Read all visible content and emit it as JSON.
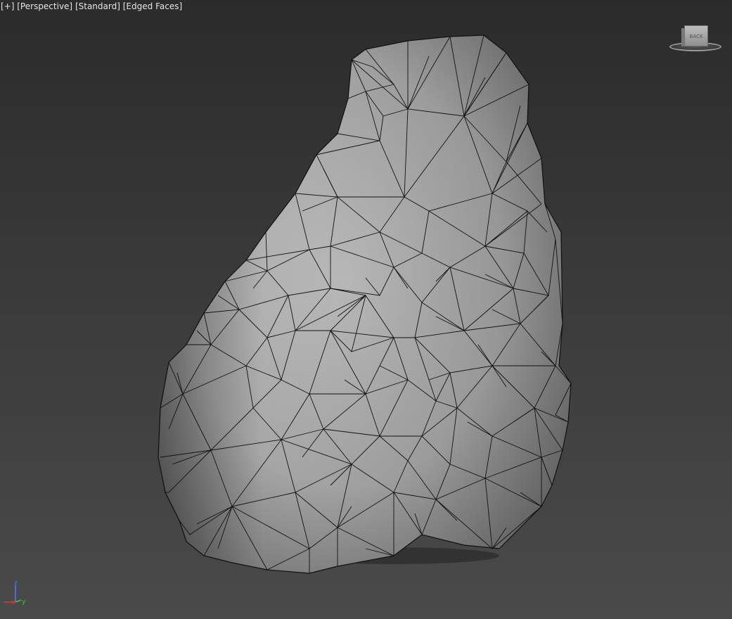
{
  "viewport": {
    "label_plus": "[+]",
    "label_view": "[Perspective]",
    "label_shading": "[Standard]",
    "label_mode": "[Edged Faces]"
  },
  "viewcube": {
    "face_label": "BACK"
  },
  "axis_gizmo": {
    "z": "z",
    "x": "x",
    "y": "y",
    "colors": {
      "x": "#d23c3c",
      "y": "#3cc83c",
      "z": "#4a7cff"
    }
  },
  "mesh": {
    "object": "rock",
    "fill_color": "#a8a8a8",
    "edge_color": "#111111"
  }
}
